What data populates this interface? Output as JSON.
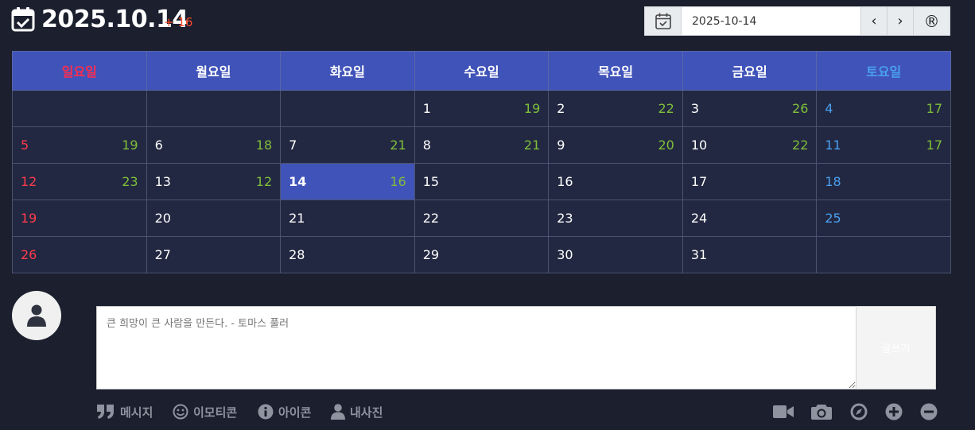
{
  "header": {
    "date": "2025.10.14",
    "count": "+ 16"
  },
  "picker": {
    "value": "2025-10-14",
    "prev_label": "‹",
    "next_label": "›",
    "reg_label": "®"
  },
  "calendar": {
    "weekdays": [
      "일요일",
      "월요일",
      "화요일",
      "수요일",
      "목요일",
      "금요일",
      "토요일"
    ],
    "weeks": [
      [
        {
          "d": "",
          "c": ""
        },
        {
          "d": "",
          "c": ""
        },
        {
          "d": "",
          "c": ""
        },
        {
          "d": "1",
          "c": "19"
        },
        {
          "d": "2",
          "c": "22"
        },
        {
          "d": "3",
          "c": "26"
        },
        {
          "d": "4",
          "c": "17"
        }
      ],
      [
        {
          "d": "5",
          "c": "19"
        },
        {
          "d": "6",
          "c": "18"
        },
        {
          "d": "7",
          "c": "21"
        },
        {
          "d": "8",
          "c": "21"
        },
        {
          "d": "9",
          "c": "20"
        },
        {
          "d": "10",
          "c": "22"
        },
        {
          "d": "11",
          "c": "17"
        }
      ],
      [
        {
          "d": "12",
          "c": "23"
        },
        {
          "d": "13",
          "c": "12"
        },
        {
          "d": "14",
          "c": "16"
        },
        {
          "d": "15",
          "c": ""
        },
        {
          "d": "16",
          "c": ""
        },
        {
          "d": "17",
          "c": ""
        },
        {
          "d": "18",
          "c": ""
        }
      ],
      [
        {
          "d": "19",
          "c": ""
        },
        {
          "d": "20",
          "c": ""
        },
        {
          "d": "21",
          "c": ""
        },
        {
          "d": "22",
          "c": ""
        },
        {
          "d": "23",
          "c": ""
        },
        {
          "d": "24",
          "c": ""
        },
        {
          "d": "25",
          "c": ""
        }
      ],
      [
        {
          "d": "26",
          "c": ""
        },
        {
          "d": "27",
          "c": ""
        },
        {
          "d": "28",
          "c": ""
        },
        {
          "d": "29",
          "c": ""
        },
        {
          "d": "30",
          "c": ""
        },
        {
          "d": "31",
          "c": ""
        },
        {
          "d": "",
          "c": ""
        }
      ]
    ],
    "today": "14"
  },
  "composer": {
    "placeholder": "큰 희망이 큰 사람을 만든다. - 토마스 풀러",
    "send_label": "글쓰기"
  },
  "toolbar": {
    "message": "메시지",
    "emoticon": "이모티콘",
    "icon": "아이콘",
    "my_photo": "내사진"
  },
  "colors": {
    "background": "#1b1f2e",
    "header_row": "#4053b8",
    "cell": "#222841",
    "sunday": "#ff3b4e",
    "saturday": "#4a9ff0",
    "count": "#7fbf3a",
    "accent_count": "#ff4b2b"
  }
}
